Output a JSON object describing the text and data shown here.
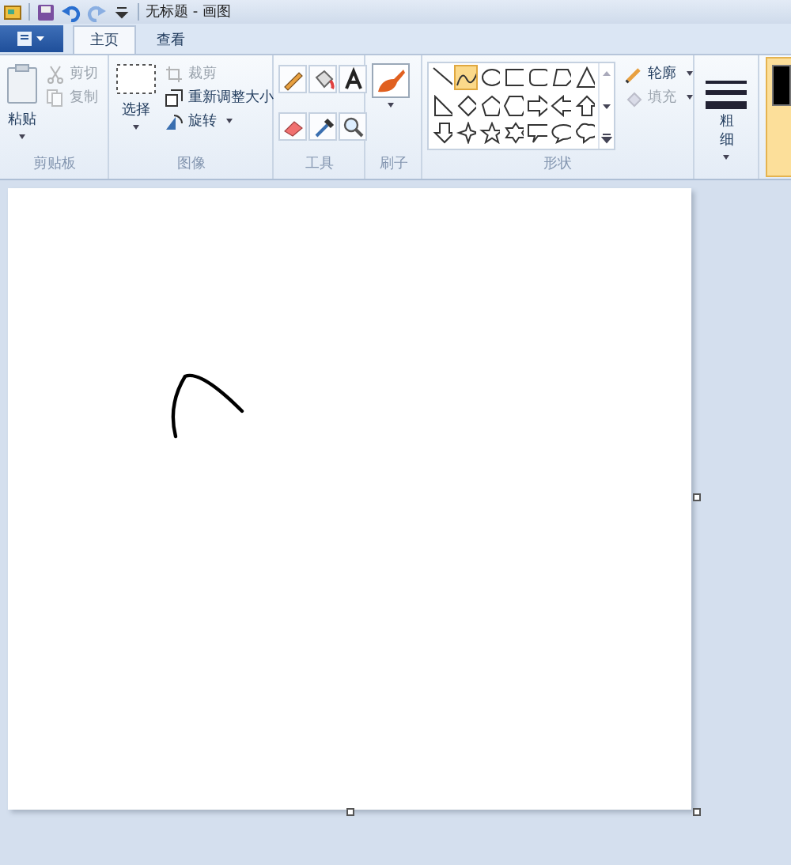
{
  "title_bar": {
    "title": "无标题 - 画图",
    "quick_access": [
      {
        "kind": "save",
        "disabled": false
      },
      {
        "kind": "undo",
        "disabled": false
      },
      {
        "kind": "redo",
        "disabled": true
      },
      {
        "kind": "more",
        "disabled": false
      }
    ]
  },
  "tabs": [
    {
      "label": "主页",
      "selected": true
    },
    {
      "label": "查看",
      "selected": false
    }
  ],
  "clipboard": {
    "label": "剪贴板",
    "paste": "粘贴",
    "small": [
      {
        "kind": "cut",
        "label": "剪切",
        "disabled": true
      },
      {
        "kind": "copy",
        "label": "复制",
        "disabled": true
      }
    ]
  },
  "image": {
    "label": "图像",
    "select": "选择",
    "small": [
      {
        "kind": "crop",
        "label": "裁剪",
        "disabled": true
      },
      {
        "kind": "resize",
        "label": "重新调整大小",
        "disabled": false
      },
      {
        "kind": "rotate",
        "label": "旋转",
        "disabled": false
      }
    ]
  },
  "tools": {
    "label": "工具",
    "items": [
      {
        "kind": "pencil"
      },
      {
        "kind": "fill"
      },
      {
        "kind": "text"
      },
      {
        "kind": "eraser"
      },
      {
        "kind": "picker"
      },
      {
        "kind": "magnifier"
      }
    ]
  },
  "brushes": {
    "label": "刷子"
  },
  "shapes": {
    "label": "形状",
    "items": [
      {
        "kind": "line",
        "selected": false
      },
      {
        "kind": "curve",
        "selected": true
      },
      {
        "kind": "oval",
        "selected": false
      },
      {
        "kind": "rect",
        "selected": false
      },
      {
        "kind": "roundrect",
        "selected": false
      },
      {
        "kind": "polygon",
        "selected": false
      },
      {
        "kind": "triangle",
        "selected": false
      },
      {
        "kind": "righttriangle",
        "selected": false
      },
      {
        "kind": "diamond",
        "selected": false
      },
      {
        "kind": "pentagon",
        "selected": false
      },
      {
        "kind": "hexagon",
        "selected": false
      },
      {
        "kind": "rightarrow",
        "selected": false
      },
      {
        "kind": "leftarrow",
        "selected": false
      },
      {
        "kind": "uparrow",
        "selected": false
      },
      {
        "kind": "downarrow",
        "selected": false
      },
      {
        "kind": "star4",
        "selected": false
      },
      {
        "kind": "star5",
        "selected": false
      },
      {
        "kind": "star6",
        "selected": false
      },
      {
        "kind": "rectcallout",
        "selected": false
      },
      {
        "kind": "ovalcallout",
        "selected": false
      },
      {
        "kind": "cloudcallout",
        "selected": false
      }
    ],
    "options": [
      {
        "kind": "outline",
        "label": "轮廓",
        "disabled": false
      },
      {
        "kind": "fill",
        "label": "填充",
        "disabled": true
      }
    ]
  },
  "size": {
    "label": "粗细"
  },
  "color1": {
    "color": "#000000",
    "selected": true
  }
}
